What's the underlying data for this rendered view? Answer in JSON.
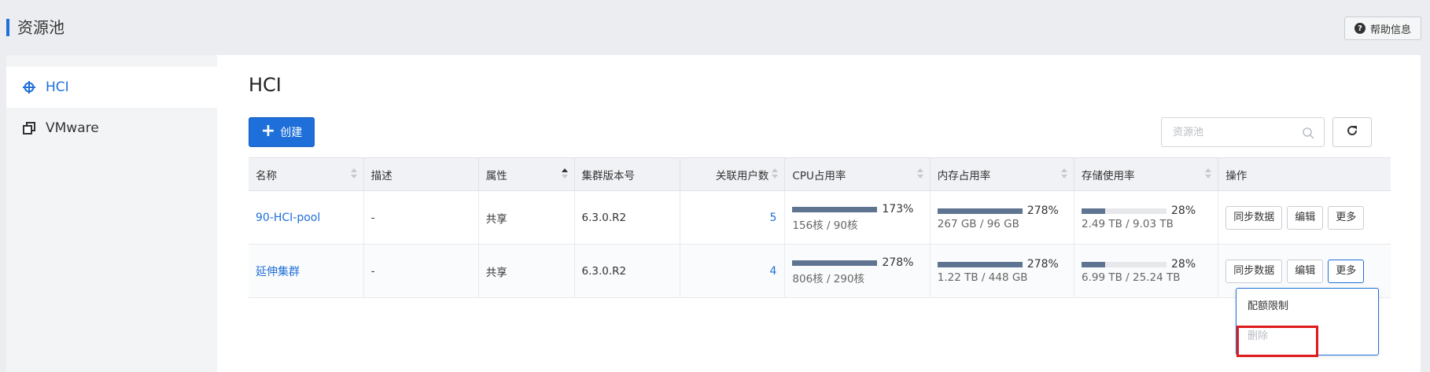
{
  "page": {
    "title": "资源池",
    "help_label": "帮助信息"
  },
  "sidebar": {
    "items": [
      {
        "label": "HCI",
        "icon": "hci-icon",
        "active": true
      },
      {
        "label": "VMware",
        "icon": "vmware-icon",
        "active": false
      }
    ]
  },
  "main": {
    "title": "HCI",
    "create_label": "创建",
    "search_placeholder": "资源池"
  },
  "table": {
    "columns": [
      "名称",
      "描述",
      "属性",
      "集群版本号",
      "关联用户数",
      "CPU占用率",
      "内存占用率",
      "存储使用率",
      "操作"
    ],
    "rows": [
      {
        "name": "90-HCI-pool",
        "desc": "-",
        "attr": "共享",
        "version": "6.3.0.R2",
        "users": "5",
        "cpu_pct": "173%",
        "cpu_detail": "156核 / 90核",
        "cpu_fill": 1.0,
        "mem_pct": "278%",
        "mem_detail": "267 GB / 96 GB",
        "mem_fill": 1.0,
        "storage_pct": "28%",
        "storage_detail": "2.49 TB / 9.03 TB",
        "storage_fill": 0.28
      },
      {
        "name": "延伸集群",
        "desc": "-",
        "attr": "共享",
        "version": "6.3.0.R2",
        "users": "4",
        "cpu_pct": "278%",
        "cpu_detail": "806核 / 290核",
        "cpu_fill": 1.0,
        "mem_pct": "278%",
        "mem_detail": "1.22 TB / 448 GB",
        "mem_fill": 1.0,
        "storage_pct": "28%",
        "storage_detail": "6.99 TB / 25.24 TB",
        "storage_fill": 0.28
      }
    ],
    "actions": {
      "sync": "同步数据",
      "edit": "编辑",
      "more": "更多"
    }
  },
  "dropdown": {
    "items": [
      {
        "label": "配额限制",
        "disabled": false
      },
      {
        "label": "删除",
        "disabled": true
      }
    ]
  },
  "colors": {
    "accent": "#1e6fd9",
    "bar_fill": "#5f7490",
    "highlight": "#e01b1b"
  }
}
